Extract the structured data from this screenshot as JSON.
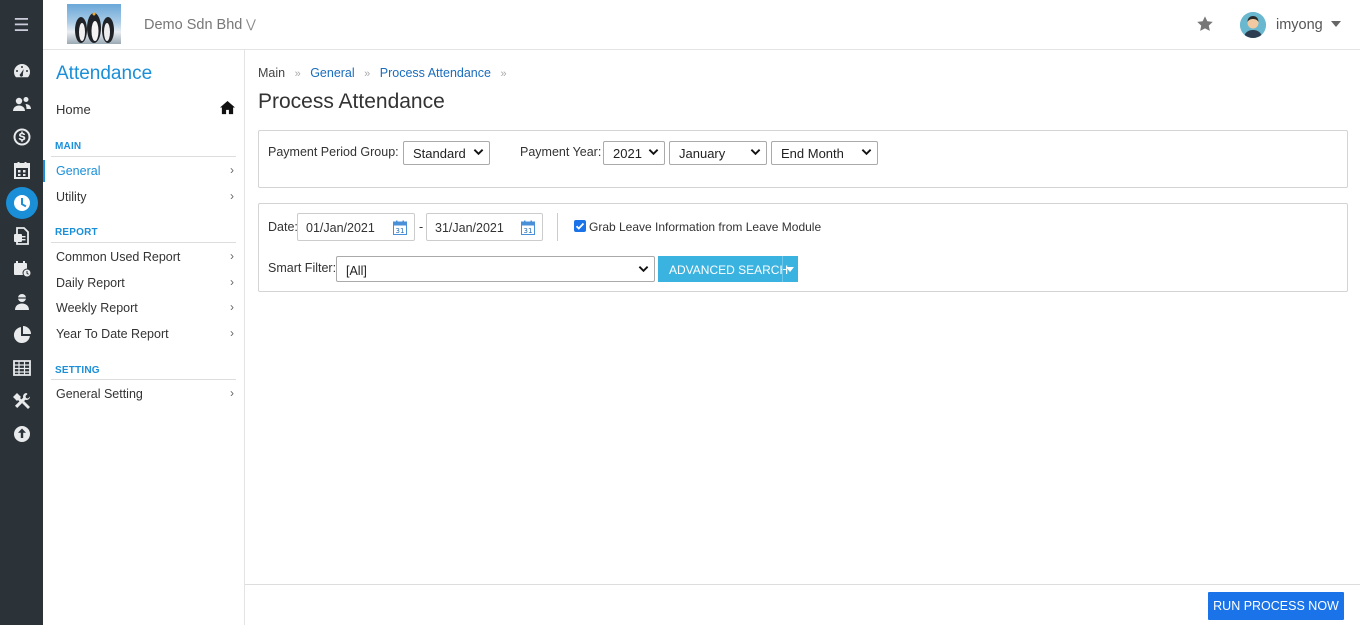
{
  "header": {
    "company": "Demo Sdn Bhd",
    "username": "imyong"
  },
  "rail": {
    "icons": [
      "menu-icon",
      "dashboard-icon",
      "people-icon",
      "payroll-icon",
      "calendar-icon",
      "attendance-clock-icon",
      "document-icon",
      "leave-calendar-icon",
      "employee-icon",
      "pie-chart-icon",
      "table-icon",
      "tools-icon",
      "upload-icon"
    ]
  },
  "sidebar": {
    "title": "Attendance",
    "home": "Home",
    "sections": {
      "main": "MAIN",
      "report": "REPORT",
      "setting": "SETTING"
    },
    "items": {
      "general": "General",
      "utility": "Utility",
      "common_used_report": "Common Used Report",
      "daily_report": "Daily Report",
      "weekly_report": "Weekly Report",
      "ytd_report": "Year To Date Report",
      "general_setting": "General Setting"
    },
    "chevron": "›"
  },
  "breadcrumb": {
    "main": "Main",
    "general": "General",
    "process": "Process Attendance",
    "sep": "»"
  },
  "page": {
    "title": "Process Attendance"
  },
  "filters": {
    "period_group_label": "Payment Period Group:",
    "period_group_value": "Standard",
    "year_label": "Payment Year:",
    "year_value": "2021",
    "month_value": "January",
    "period_value": "End Month",
    "date_label": "Date:",
    "date_from": "01/Jan/2021",
    "date_dash": "-",
    "date_to": "31/Jan/2021",
    "grab_leave_label": "Grab Leave Information from Leave Module",
    "grab_leave_checked": true,
    "smart_filter_label": "Smart Filter:",
    "smart_filter_value": "[All]",
    "advanced_search": "ADVANCED SEARCH"
  },
  "footer": {
    "run_button": "RUN PROCESS NOW"
  },
  "colors": {
    "accent": "#1a8fd8",
    "rail_bg": "#2b3238",
    "primary_button": "#1a73e8",
    "info_button": "#3bb3e0"
  }
}
